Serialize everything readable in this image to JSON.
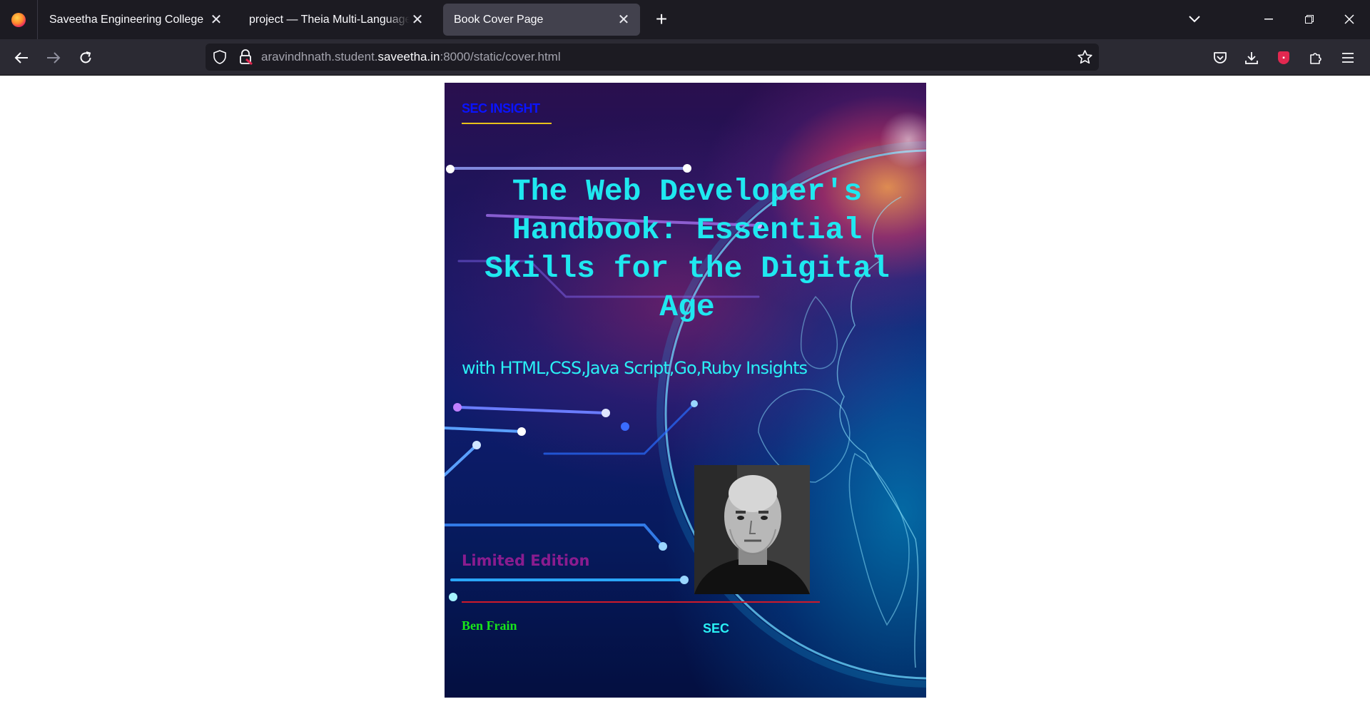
{
  "browser": {
    "tabs": [
      {
        "title": "Saveetha Engineering College",
        "active": false
      },
      {
        "title": "project — Theia Multi-Language Ex",
        "active": false
      },
      {
        "title": "Book Cover Page",
        "active": true
      }
    ],
    "url": {
      "prefix": "aravindhnath.student.",
      "host": "saveetha.in",
      "suffix": ":8000/static/cover.html"
    },
    "icons": {
      "back": "back-arrow-icon",
      "forward": "forward-arrow-icon",
      "reload": "reload-icon",
      "tracking": "shield-icon",
      "insecure": "lock-warning-icon",
      "bookmark": "star-icon",
      "pocket": "pocket-icon",
      "downloads": "download-icon",
      "addon": "ublock-icon",
      "extensions": "puzzle-icon",
      "menu": "hamburger-menu-icon"
    }
  },
  "cover": {
    "brand": "SEC INSIGHT",
    "title": "The Web Developer's Handbook: Essential Skills for the Digital Age",
    "subtitle": "with HTML,CSS,Java Script,Go,Ruby Insights",
    "edition": "Limited Edition",
    "author": "Ben Frain",
    "publisher": "SEC",
    "colors": {
      "brand": "#0a14ff",
      "title": "#1fe8f0",
      "edition": "#8a1c8f",
      "author": "#18e61a",
      "separator": "#d01a2a",
      "brand_underline": "#e8c21a"
    }
  }
}
